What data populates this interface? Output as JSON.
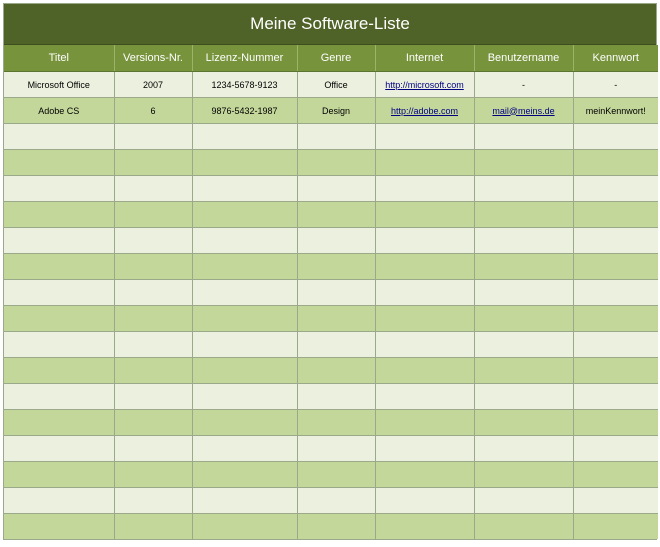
{
  "title": "Meine Software-Liste",
  "columns": [
    "Titel",
    "Versions-Nr.",
    "Lizenz-Nummer",
    "Genre",
    "Internet",
    "Benutzername",
    "Kennwort"
  ],
  "rows": [
    [
      "Microsoft Office",
      "2007",
      "1234-5678-9123",
      "Office",
      "http://microsoft.com",
      "-",
      "-"
    ],
    [
      "Adobe CS",
      "6",
      "9876-5432-1987",
      "Design",
      "http://adobe.com",
      "mail@meins.de",
      "meinKennwort!"
    ]
  ],
  "link_columns": [
    4,
    5
  ],
  "empty_row_count": 16,
  "colors": {
    "title_bg": "#4f6228",
    "header_bg": "#77933c",
    "row_light": "#ebf1de",
    "row_dark": "#c4d79b",
    "link": "#000080"
  }
}
